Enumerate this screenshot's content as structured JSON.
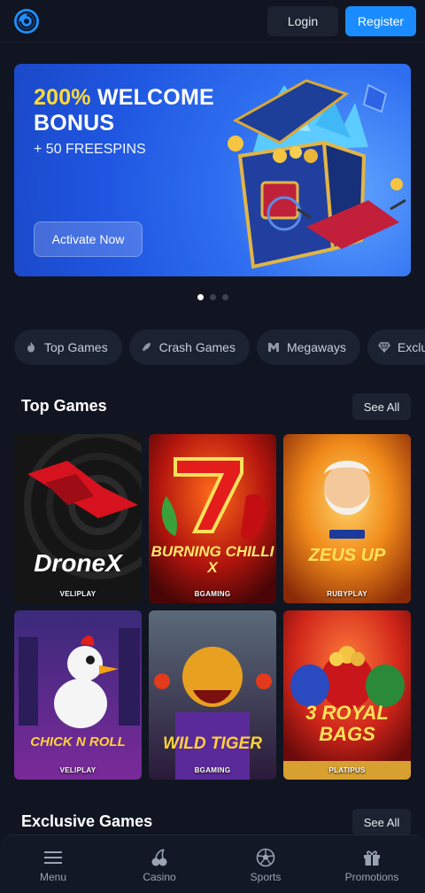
{
  "header": {
    "login_label": "Login",
    "register_label": "Register"
  },
  "banner": {
    "title_highlight": "200%",
    "title_line1_rest": "WELCOME",
    "title_line2": "BONUS",
    "subtitle": "+ 50 FREESPINS",
    "cta_label": "Activate Now",
    "active_slide": 1,
    "slide_count": 3
  },
  "categories": [
    {
      "label": "Top Games",
      "icon": "fire-icon"
    },
    {
      "label": "Crash Games",
      "icon": "rocket-icon"
    },
    {
      "label": "Megaways",
      "icon": "megaways-icon"
    },
    {
      "label": "Exclusive",
      "icon": "diamond-icon"
    }
  ],
  "top_games": {
    "title": "Top Games",
    "see_all_label": "See All",
    "items": [
      {
        "name": "DroneX",
        "provider": "VELIPLAY"
      },
      {
        "name": "BURNING CHILLI X",
        "provider": "BGAMING"
      },
      {
        "name": "ZEUS UP",
        "provider": "RUBYPLAY"
      },
      {
        "name": "CHICK N ROLL",
        "provider": "VELIPLAY"
      },
      {
        "name": "WILD TIGER",
        "provider": "BGAMING"
      },
      {
        "name": "3 ROYAL BAGS",
        "provider": "PLATIPUS"
      }
    ]
  },
  "exclusive_games": {
    "title": "Exclusive Games",
    "see_all_label": "See All"
  },
  "bottom_nav": [
    {
      "label": "Menu",
      "icon": "menu-icon"
    },
    {
      "label": "Casino",
      "icon": "cherries-icon"
    },
    {
      "label": "Sports",
      "icon": "soccer-ball-icon"
    },
    {
      "label": "Promotions",
      "icon": "gift-icon"
    }
  ],
  "colors": {
    "background": "#101521",
    "accent": "#1a8cff",
    "banner_highlight": "#ffd93b"
  }
}
